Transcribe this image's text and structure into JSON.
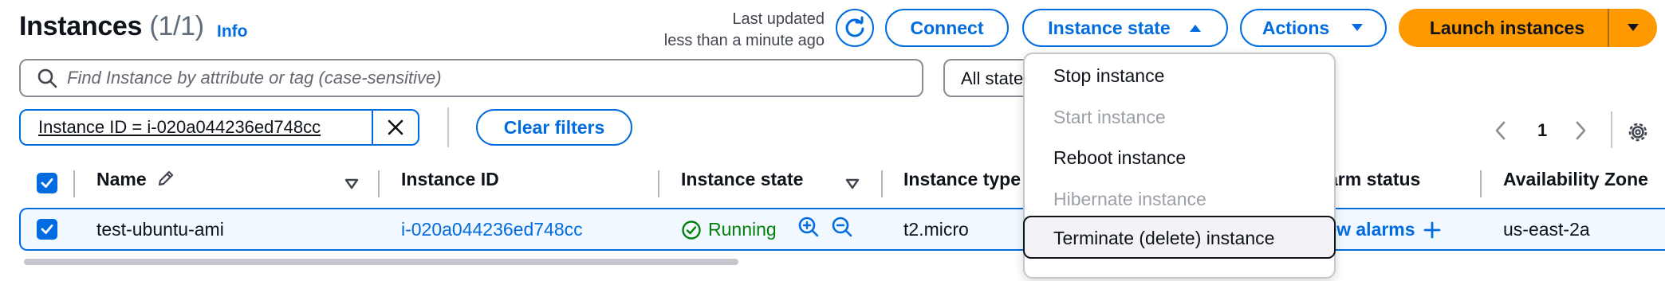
{
  "header": {
    "title": "Instances",
    "count": "(1/1)",
    "info_link": "Info",
    "last_updated_line1": "Last updated",
    "last_updated_line2": "less than a minute ago"
  },
  "toolbar": {
    "connect": "Connect",
    "instance_state": "Instance state",
    "actions": "Actions",
    "launch": "Launch instances"
  },
  "search": {
    "placeholder": "Find Instance by attribute or tag (case-sensitive)",
    "state_filter": "All states"
  },
  "filters": {
    "token": "Instance ID = i-020a044236ed748cc",
    "clear": "Clear filters"
  },
  "pagination": {
    "page": "1"
  },
  "table": {
    "columns": [
      "Name",
      "Instance ID",
      "Instance state",
      "Instance type",
      "Alarm status",
      "Availability Zone"
    ],
    "rows": [
      {
        "name": "test-ubuntu-ami",
        "instance_id": "i-020a044236ed748cc",
        "state": "Running",
        "type": "t2.micro",
        "alarm": "View alarms",
        "zone": "us-east-2a"
      }
    ]
  },
  "state_menu": {
    "items": [
      {
        "label": "Stop instance",
        "disabled": false
      },
      {
        "label": "Start instance",
        "disabled": true
      },
      {
        "label": "Reboot instance",
        "disabled": false
      },
      {
        "label": "Hibernate instance",
        "disabled": true
      },
      {
        "label": "Terminate (delete) instance",
        "disabled": false
      }
    ]
  },
  "colors": {
    "accent": "#006ce0",
    "launch": "#ff9900",
    "running": "#037f0c",
    "selected_row_bg": "#f1f8ff"
  },
  "icons": [
    "refresh-icon",
    "caret-up-icon",
    "caret-down-icon",
    "search-icon",
    "close-icon",
    "chevron-left-icon",
    "chevron-right-icon",
    "gear-icon",
    "pencil-icon",
    "sort-down-icon",
    "check-circle-icon",
    "zoom-in-icon",
    "zoom-out-icon",
    "plus-icon",
    "checkbox-checked-icon"
  ]
}
